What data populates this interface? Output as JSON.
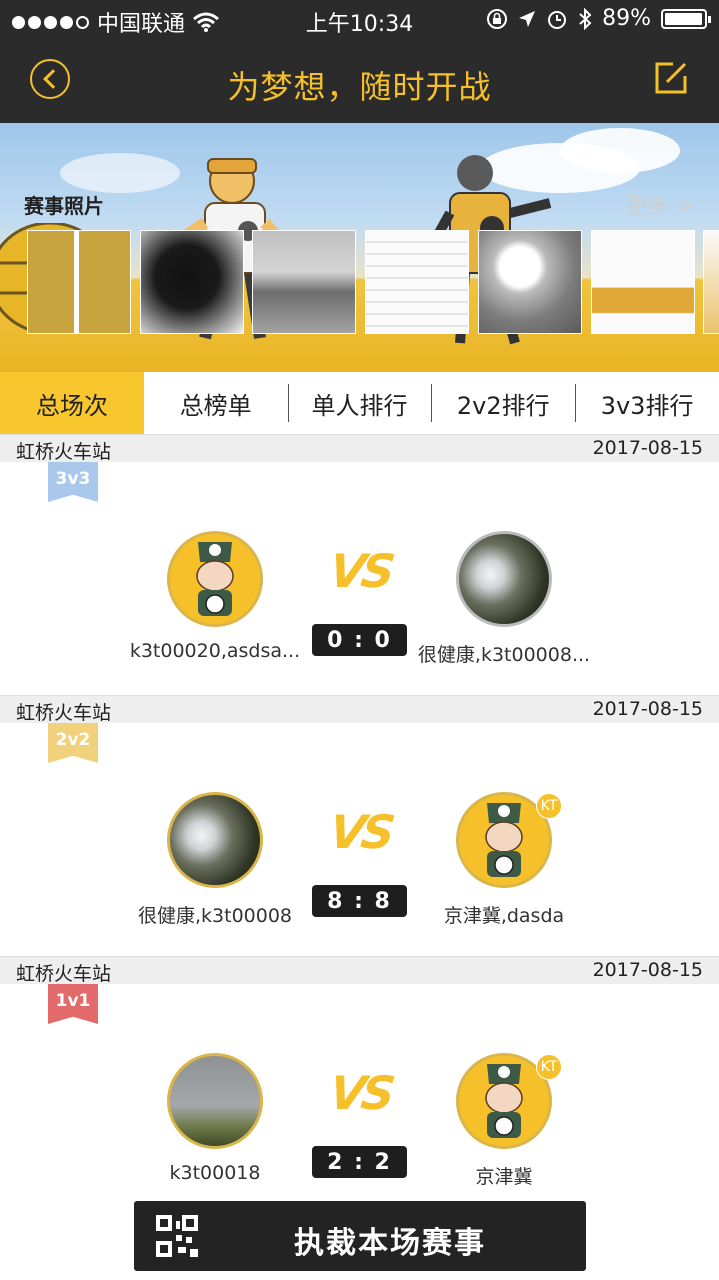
{
  "status_bar": {
    "carrier": "中国联通",
    "time": "上午10:34",
    "battery": "89%",
    "battery_level": 0.89
  },
  "nav": {
    "title": "为梦想，随时开战",
    "back_icon": "back-circle-icon",
    "edit_icon": "edit-icon"
  },
  "photos": {
    "label": "赛事照片",
    "more": "更多 >"
  },
  "tabs": [
    {
      "label": "总场次",
      "active": true
    },
    {
      "label": "总榜单",
      "active": false
    },
    {
      "label": "单人排行",
      "active": false
    },
    {
      "label": "2v2排行",
      "active": false
    },
    {
      "label": "3v3排行",
      "active": false
    }
  ],
  "matches": [
    {
      "venue": "虹桥火车站",
      "date": "2017-08-15",
      "mode": "3v3",
      "mode_color": "#a9c8ec",
      "vs": "VS",
      "score": "0 : 0",
      "left_name": "k3t00020,asdsa...",
      "right_name": "很健康,k3t00008..."
    },
    {
      "venue": "虹桥火车站",
      "date": "2017-08-15",
      "mode": "2v2",
      "mode_color": "#f1d17c",
      "vs": "VS",
      "score": "8 : 8",
      "left_name": "很健康,k3t00008",
      "right_name": "京津冀,dasda",
      "right_badge": "KT"
    },
    {
      "venue": "虹桥火车站",
      "date": "2017-08-15",
      "mode": "1v1",
      "mode_color": "#e36a6a",
      "vs": "VS",
      "score": "2 : 2",
      "left_name": "k3t00018",
      "right_name": "京津冀",
      "right_badge": "KT"
    }
  ],
  "referee_button": {
    "label": "执裁本场赛事",
    "icon": "qr-code-icon"
  },
  "colors": {
    "accent": "#f5c02a",
    "dark": "#2b2b2b"
  }
}
